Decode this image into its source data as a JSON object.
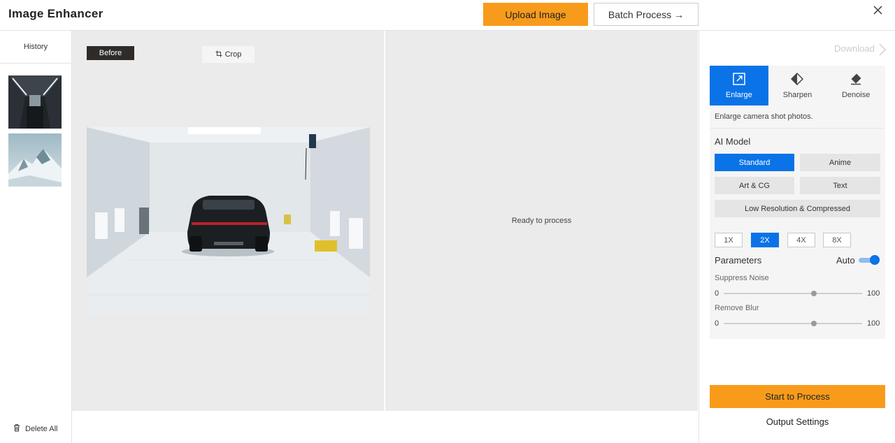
{
  "header": {
    "app_title": "Image Enhancer",
    "upload_label": "Upload Image",
    "batch_label": "Batch Process →"
  },
  "sidebar": {
    "history_label": "History",
    "delete_all_label": "Delete All"
  },
  "viewer": {
    "before_tag": "Before",
    "crop_label": "Crop",
    "ready_text": "Ready to process"
  },
  "panel": {
    "download_label": "Download",
    "tabs": [
      {
        "label": "Enlarge",
        "icon": "enlarge-icon",
        "active": true
      },
      {
        "label": "Sharpen",
        "icon": "sharpen-icon",
        "active": false
      },
      {
        "label": "Denoise",
        "icon": "eraser-icon",
        "active": false
      }
    ],
    "description": "Enlarge camera shot photos.",
    "ai_model_label": "AI Model",
    "models": [
      "Standard",
      "Anime",
      "Art & CG",
      "Text",
      "Low Resolution & Compressed"
    ],
    "selected_model": "Standard",
    "scales": [
      "1X",
      "2X",
      "4X",
      "8X"
    ],
    "selected_scale": "2X",
    "parameters_label": "Parameters",
    "auto_label": "Auto",
    "auto_enabled": true,
    "suppress_noise": {
      "label": "Suppress Noise",
      "min": "0",
      "max": "100",
      "value": 65
    },
    "remove_blur": {
      "label": "Remove Blur",
      "min": "0",
      "max": "100",
      "value": 65
    },
    "start_label": "Start to Process",
    "output_settings_label": "Output Settings"
  },
  "colors": {
    "accent": "#0a73e8",
    "primary_button": "#f89b1b"
  }
}
